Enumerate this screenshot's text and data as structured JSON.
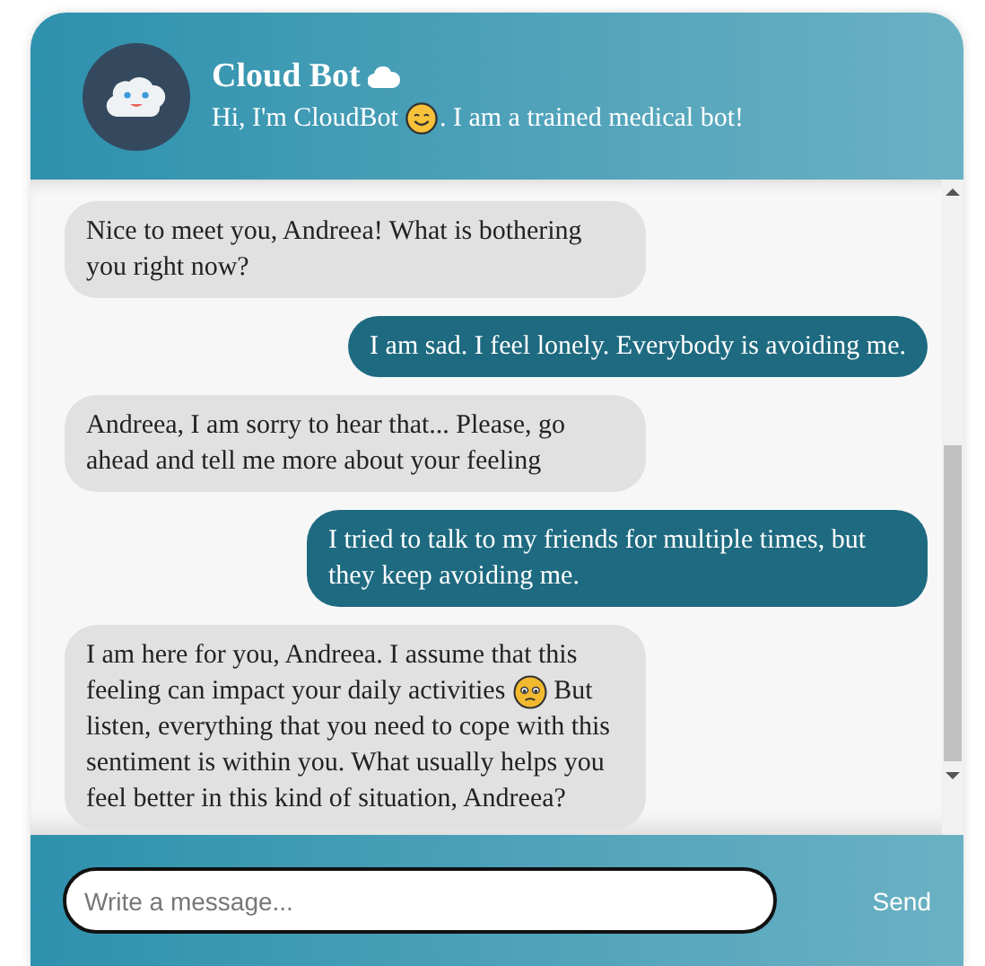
{
  "header": {
    "title": "Cloud Bot",
    "subtitle_parts": [
      {
        "kind": "text",
        "text": "Hi, I'm CloudBot"
      },
      {
        "kind": "smile"
      },
      {
        "kind": "text",
        "text": ". I am a trained medical bot!"
      }
    ]
  },
  "messages": [
    {
      "kind": "bot",
      "lines": [
        [
          {
            "kind": "text",
            "text": "Nice to meet you, Andreea! What is bothering you right now?"
          }
        ]
      ]
    },
    {
      "kind": "user",
      "lines": [
        [
          {
            "kind": "text",
            "text": "I am sad. I feel lonely. Everybody is avoiding me."
          }
        ]
      ]
    },
    {
      "kind": "bot",
      "lines": [
        [
          {
            "kind": "text",
            "text": "Andreea, I am sorry to hear that... Please, go ahead and tell me more about your feeling"
          }
        ]
      ]
    },
    {
      "kind": "user",
      "lines": [
        [
          {
            "kind": "text",
            "text": "I tried to talk to my friends for multiple times, but they keep avoiding me."
          }
        ]
      ]
    },
    {
      "kind": "bot",
      "lines": [
        [
          {
            "kind": "text",
            "text": "I am here for you, Andreea. I assume that this"
          }
        ],
        [
          {
            "kind": "text",
            "text": "feeling can impact your daily activities"
          },
          {
            "kind": "sad"
          },
          {
            "kind": "text",
            "text": "But"
          }
        ],
        [
          {
            "kind": "text",
            "text": "listen, everything that you need to cope with this sentiment is within you. What usually helps you feel better in this kind of situation, Andreea?"
          }
        ]
      ]
    }
  ],
  "composer": {
    "placeholder": "Write a message...",
    "send_label": "Send"
  }
}
